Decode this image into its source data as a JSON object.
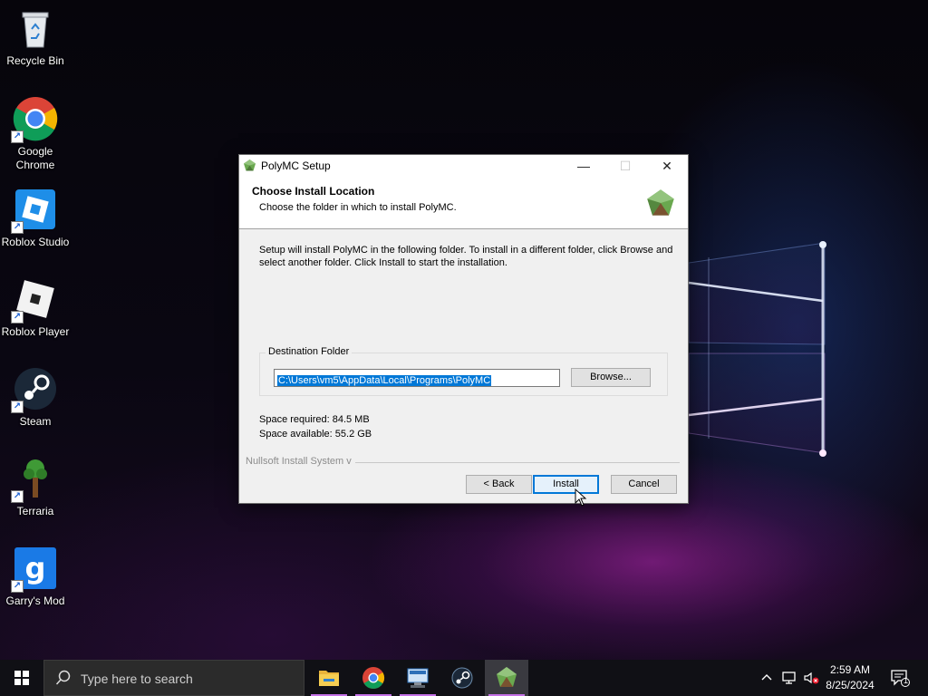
{
  "desktop": {
    "icons": [
      {
        "label": "Recycle Bin",
        "icon": "recycle-bin-icon"
      },
      {
        "label": "Google Chrome",
        "icon": "chrome-icon"
      },
      {
        "label": "Roblox Studio",
        "icon": "roblox-studio-icon"
      },
      {
        "label": "Roblox Player",
        "icon": "roblox-player-icon"
      },
      {
        "label": "Steam",
        "icon": "steam-icon"
      },
      {
        "label": "Terraria",
        "icon": "terraria-icon"
      },
      {
        "label": "Garry's Mod",
        "icon": "garrys-mod-icon"
      }
    ]
  },
  "dialog": {
    "title": "PolyMC Setup",
    "header_title": "Choose Install Location",
    "header_subtitle": "Choose the folder in which to install PolyMC.",
    "description": "Setup will install PolyMC in the following folder. To install in a different folder, click Browse and select another folder. Click Install to start the installation.",
    "destination_label": "Destination Folder",
    "path_value": "C:\\Users\\vm5\\AppData\\Local\\Programs\\PolyMC",
    "browse_label": "Browse...",
    "space_required": "Space required: 84.5 MB",
    "space_available": "Space available: 55.2 GB",
    "nsis_label": "Nullsoft Install System v",
    "back_label": "< Back",
    "install_label": "Install",
    "cancel_label": "Cancel",
    "minimize_glyph": "—",
    "maximize_glyph": "☐",
    "close_glyph": "✕"
  },
  "taskbar": {
    "search_placeholder": "Type here to search",
    "pinned": [
      "file-explorer-icon",
      "chrome-icon",
      "network-app-icon",
      "steam-icon",
      "polymc-icon"
    ],
    "time": "2:59 AM",
    "date": "8/25/2024",
    "notification_count": "1"
  },
  "colors": {
    "accent": "#0078d7",
    "taskbar_indicator": "#c471e6",
    "polymc_green": "#6aa84f"
  }
}
